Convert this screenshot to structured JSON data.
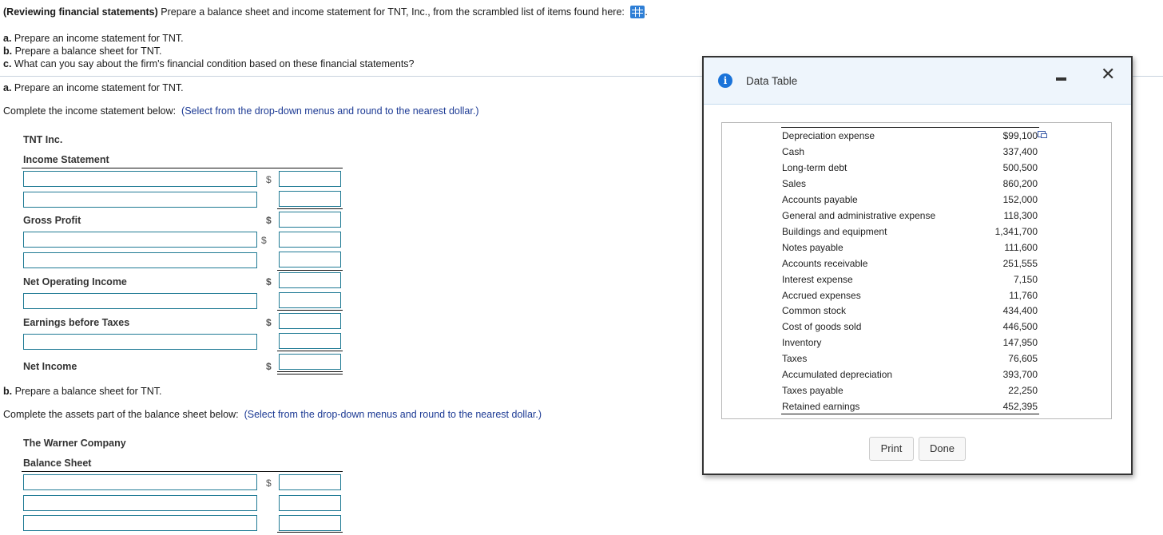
{
  "question": {
    "intro_bold": "(Reviewing financial statements)",
    "intro_text": " Prepare a balance sheet and income statement for TNT, Inc., from the scrambled list of items found here: ",
    "intro_end": ".",
    "data_icon": "grid-table-icon",
    "parts": [
      {
        "letter": "a.",
        "text": " Prepare an income statement for TNT."
      },
      {
        "letter": "b.",
        "text": " Prepare a balance sheet for TNT."
      },
      {
        "letter": "c.",
        "text": " What can you say about the firm's financial condition based on these financial statements?"
      }
    ]
  },
  "part_a": {
    "letter": "a.",
    "heading": " Prepare an income statement for TNT.",
    "instruction": "Complete the income statement below:",
    "hint": "(Select from the drop-down menus and round to the nearest dollar.)",
    "company": "TNT Inc.",
    "statement_title": "Income Statement",
    "labels": {
      "gross_profit": "Gross Profit",
      "net_operating_income": "Net Operating Income",
      "earnings_before_taxes": "Earnings before Taxes",
      "net_income": "Net Income"
    },
    "currency_symbol": "$",
    "inputs": {
      "selects": [
        "",
        "",
        "",
        "",
        "",
        ""
      ],
      "amounts": [
        "",
        "",
        "",
        "",
        "",
        "",
        "",
        "",
        "",
        ""
      ]
    }
  },
  "part_b": {
    "letter": "b.",
    "heading": " Prepare a balance sheet for TNT.",
    "instruction": "Complete the assets part of the balance sheet below:",
    "hint": "(Select from the drop-down menus and round to the nearest dollar.)",
    "company": "The Warner Company",
    "statement_title": "Balance Sheet",
    "currency_symbol": "$",
    "inputs": {
      "selects": [
        "",
        "",
        ""
      ],
      "amounts": [
        "",
        "",
        ""
      ]
    }
  },
  "modal": {
    "title": "Data Table",
    "info_icon": "info-icon",
    "rows": [
      {
        "label": "Depreciation expense",
        "value": "$99,100"
      },
      {
        "label": "Cash",
        "value": "337,400"
      },
      {
        "label": "Long-term debt",
        "value": "500,500"
      },
      {
        "label": "Sales",
        "value": "860,200"
      },
      {
        "label": "Accounts payable",
        "value": "152,000"
      },
      {
        "label": "General and administrative expense",
        "value": "118,300"
      },
      {
        "label": "Buildings and equipment",
        "value": "1,341,700"
      },
      {
        "label": "Notes payable",
        "value": "111,600"
      },
      {
        "label": "Accounts receivable",
        "value": "251,555"
      },
      {
        "label": "Interest expense",
        "value": "7,150"
      },
      {
        "label": "Accrued expenses",
        "value": "11,760"
      },
      {
        "label": "Common stock",
        "value": "434,400"
      },
      {
        "label": "Cost of goods sold",
        "value": "446,500"
      },
      {
        "label": "Inventory",
        "value": "147,950"
      },
      {
        "label": "Taxes",
        "value": "76,605"
      },
      {
        "label": "Accumulated depreciation",
        "value": "393,700"
      },
      {
        "label": "Taxes payable",
        "value": "22,250"
      },
      {
        "label": "Retained earnings",
        "value": "452,395"
      }
    ],
    "print_label": "Print",
    "done_label": "Done"
  }
}
